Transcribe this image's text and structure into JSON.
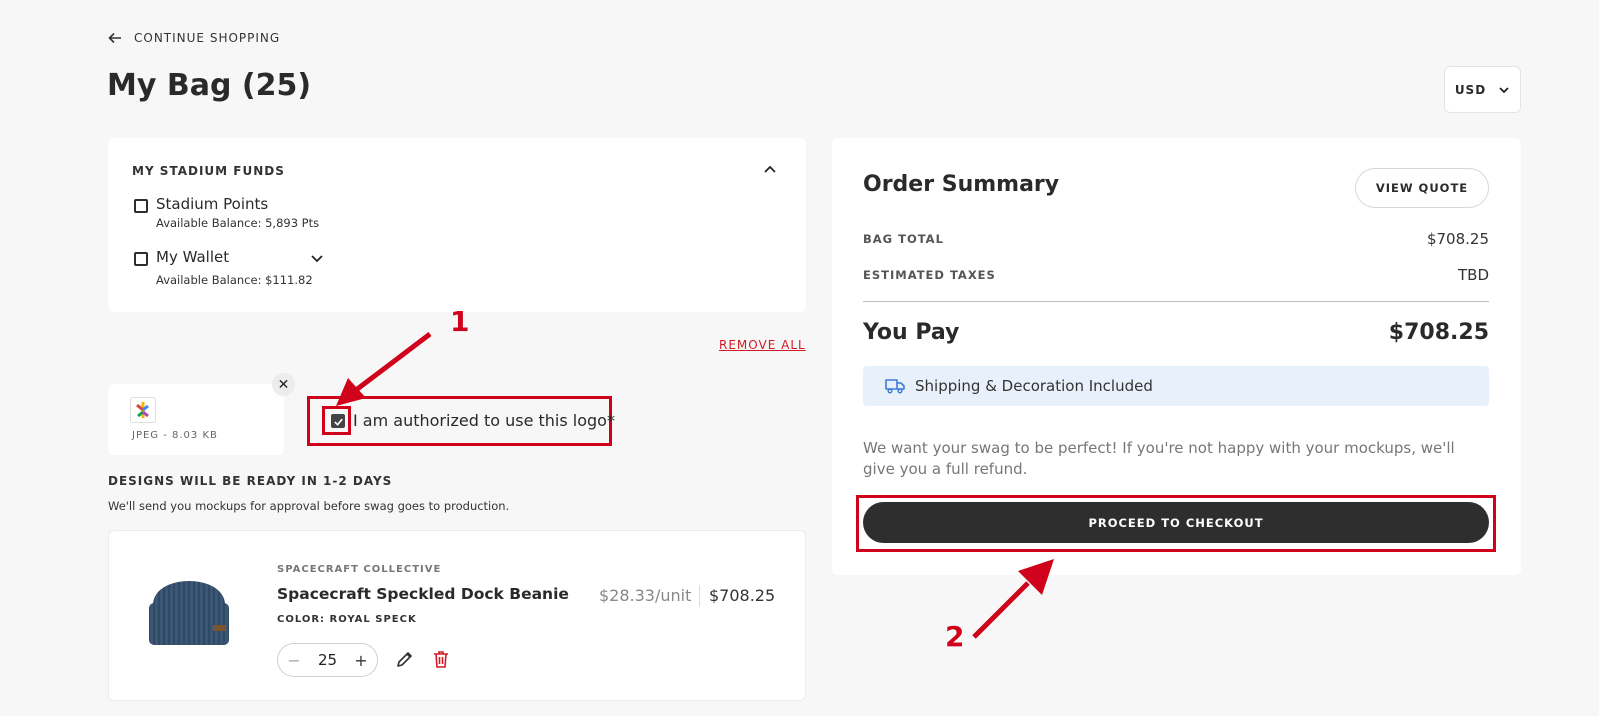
{
  "nav": {
    "back_label": "CONTINUE SHOPPING"
  },
  "page": {
    "title": "My Bag (25)"
  },
  "currency": {
    "selected": "USD"
  },
  "funds": {
    "title": "MY STADIUM FUNDS",
    "items": [
      {
        "name": "Stadium Points",
        "balance": "Available Balance: 5,893 Pts",
        "checked": false
      },
      {
        "name": "My Wallet",
        "balance": "Available Balance: $111.82",
        "checked": false
      }
    ]
  },
  "bag": {
    "remove_all_label": "REMOVE ALL"
  },
  "upload": {
    "meta": "JPEG - 8.03 KB",
    "close_glyph": "✕"
  },
  "authorization": {
    "label": "I am authorized to use this logo*",
    "checked": true
  },
  "designs": {
    "title": "DESIGNS WILL BE READY IN 1-2 DAYS",
    "subtitle": "We'll send you mockups for approval before swag goes to production."
  },
  "item": {
    "brand": "SPACECRAFT COLLECTIVE",
    "name": "Spacecraft Speckled Dock Beanie",
    "color": "COLOR: ROYAL SPECK",
    "unit_price": "$28.33/unit",
    "total": "$708.25",
    "quantity": "25",
    "minus_glyph": "−",
    "plus_glyph": "+"
  },
  "summary": {
    "title": "Order Summary",
    "view_quote_label": "VIEW QUOTE",
    "rows": [
      {
        "label": "BAG TOTAL",
        "value": "$708.25"
      },
      {
        "label": "ESTIMATED TAXES",
        "value": "TBD"
      }
    ],
    "you_pay_label": "You Pay",
    "you_pay_value": "$708.25",
    "shipping_label": "Shipping & Decoration Included",
    "note": "We want your swag to be perfect! If you're not happy with your mockups, we'll give you a full refund.",
    "checkout_label": "PROCEED TO CHECKOUT"
  },
  "annotations": {
    "marker_1": "1",
    "marker_2": "2"
  },
  "icons": [
    "arrow-left-icon",
    "chevron-down-icon",
    "chevron-up-icon",
    "close-icon",
    "check-icon",
    "truck-icon",
    "pencil-icon",
    "trash-icon"
  ],
  "colors": {
    "accent_red": "#d0021b",
    "dark_button": "#2e2e2e",
    "shipping_bg": "#e8f1fb"
  }
}
